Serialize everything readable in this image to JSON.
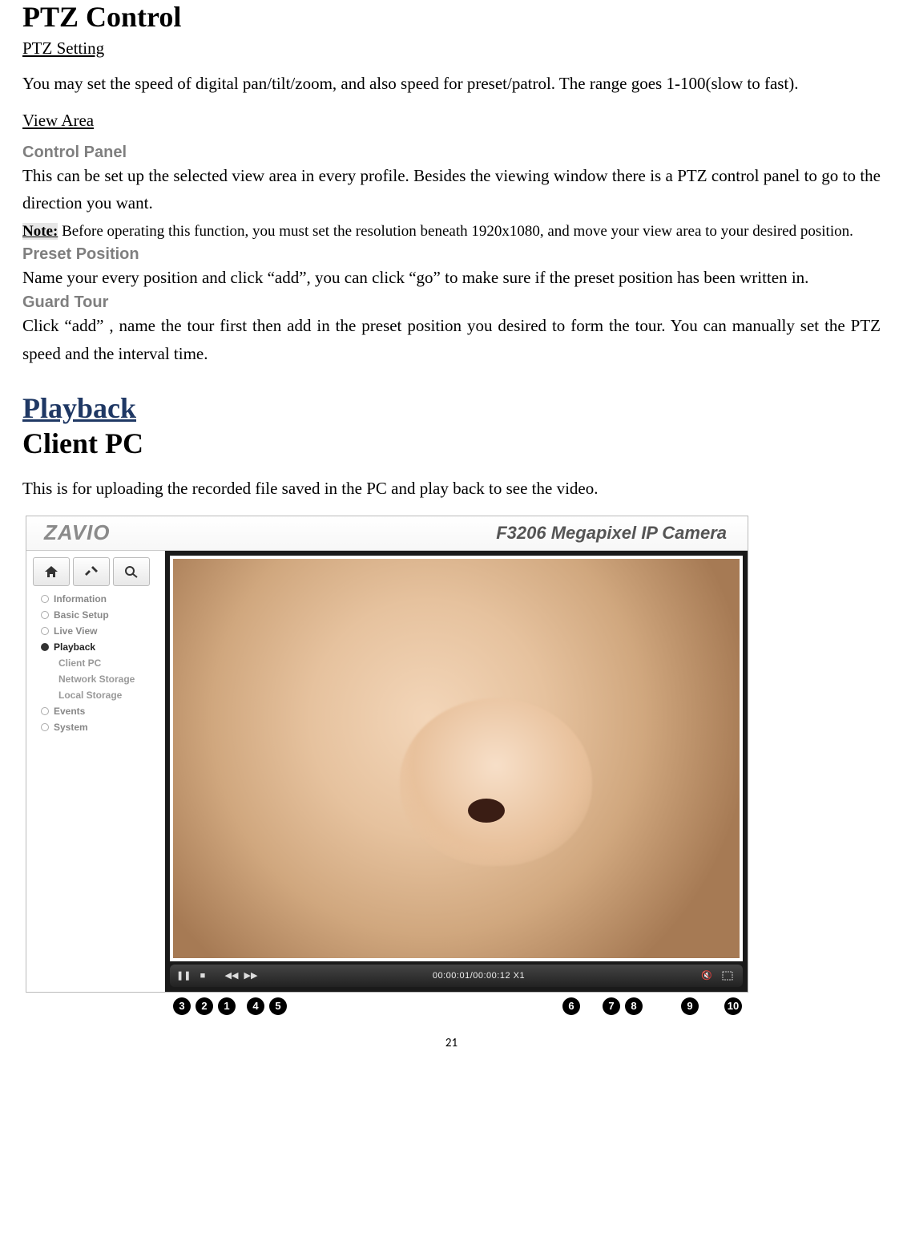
{
  "titles": {
    "ptz_control": "PTZ Control",
    "playback": "Playback",
    "client_pc": "Client PC"
  },
  "links": {
    "ptz_setting": "PTZ Setting",
    "view_area": "View Area"
  },
  "subs": {
    "control_panel": "Control Panel",
    "preset_position": "Preset Position",
    "guard_tour": "Guard Tour"
  },
  "paras": {
    "ptz_speed": "You may set the speed of digital pan/tilt/zoom, and also speed for preset/patrol. The range goes 1-100(slow to fast).",
    "control_panel": "This can be set up the selected view area in every profile. Besides the viewing window there is a PTZ control panel to go to the direction you want.",
    "note_label": "Note:",
    "note_text": " Before operating this function, you must set the resolution beneath 1920x1080, and move your view area to your desired position.",
    "preset": "Name your every position and click “add”, you can click “go” to make sure if the preset position has been written in.",
    "guard": "Click “add” , name the tour first then add in the preset position you desired to form the tour. You can manually set the PTZ speed and the interval time.",
    "client_pc": "This is for uploading the recorded file saved in the PC and play back to see the video."
  },
  "figure": {
    "brand": "ZAVIO",
    "camera_title": "F3206 Megapixel IP Camera",
    "nav": {
      "information": "Information",
      "basic_setup": "Basic Setup",
      "live_view": "Live View",
      "playback": "Playback",
      "client_pc": "Client PC",
      "network_storage": "Network Storage",
      "local_storage": "Local Storage",
      "events": "Events",
      "system": "System"
    },
    "controls": {
      "time": "00:00:01/00:00:12  X1"
    }
  },
  "numbers": [
    "3",
    "2",
    "1",
    "4",
    "5",
    "6",
    "7",
    "8",
    "9",
    "10"
  ],
  "page_number": "21"
}
